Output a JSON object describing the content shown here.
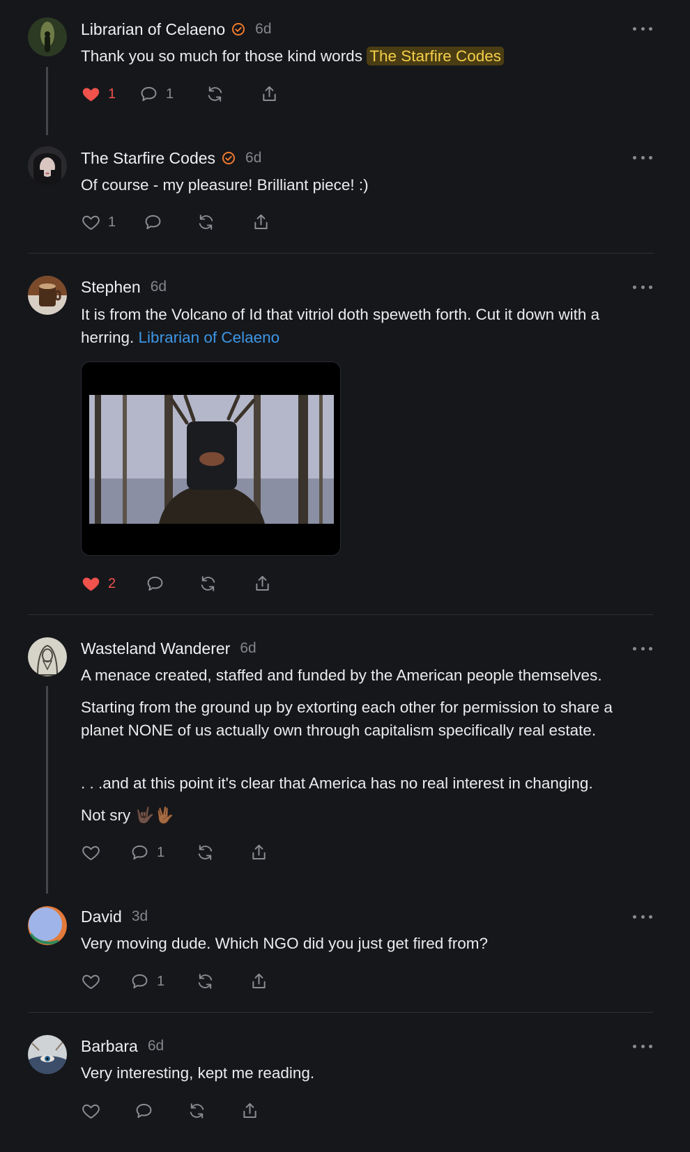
{
  "comments": [
    {
      "name": "Librarian of Celaeno",
      "verified": true,
      "time": "6d",
      "text": "Thank you so much for those kind words ",
      "mention": "The Starfire Codes",
      "likes": "1",
      "liked": true,
      "replies": "1"
    },
    {
      "name": "The Starfire Codes",
      "verified": true,
      "time": "6d",
      "text": "Of course - my pleasure! Brilliant piece! :)",
      "likes": "1",
      "liked": false,
      "replies": ""
    },
    {
      "name": "Stephen",
      "verified": false,
      "time": "6d",
      "text": "It is from the Volcano of Id that vitriol doth speweth forth. Cut it down with a herring. ",
      "mention": "Librarian of Celaeno",
      "likes": "2",
      "liked": true,
      "replies": ""
    },
    {
      "name": "Wasteland Wanderer",
      "verified": false,
      "time": "6d",
      "paragraphs": [
        "A menace created, staffed and funded by the American people themselves.",
        "Starting from the ground up by extorting each other for permission to share a planet NONE of us actually own through capitalism specifically real estate.",
        ". . .and at this point it's clear that America has no real interest in changing.",
        "Not sry 🤟🏿🖖🏾"
      ],
      "likes": "",
      "liked": false,
      "replies": "1"
    },
    {
      "name": "David",
      "verified": false,
      "time": "3d",
      "text": "Very moving dude. Which NGO did you just get fired from?",
      "likes": "",
      "liked": false,
      "replies": "1"
    },
    {
      "name": "Barbara",
      "verified": false,
      "time": "6d",
      "text": "Very interesting, kept me reading.",
      "likes": "",
      "liked": false,
      "replies": ""
    }
  ],
  "colors": {
    "background": "#16171b",
    "like_active": "#f0524c",
    "verified": "#f07a2c",
    "mention_link": "#3d97e6",
    "mention_highlight": "#f5cf4a"
  },
  "icons": [
    "heart-icon",
    "comment-icon",
    "restack-icon",
    "share-icon",
    "more-icon",
    "verified-icon"
  ]
}
